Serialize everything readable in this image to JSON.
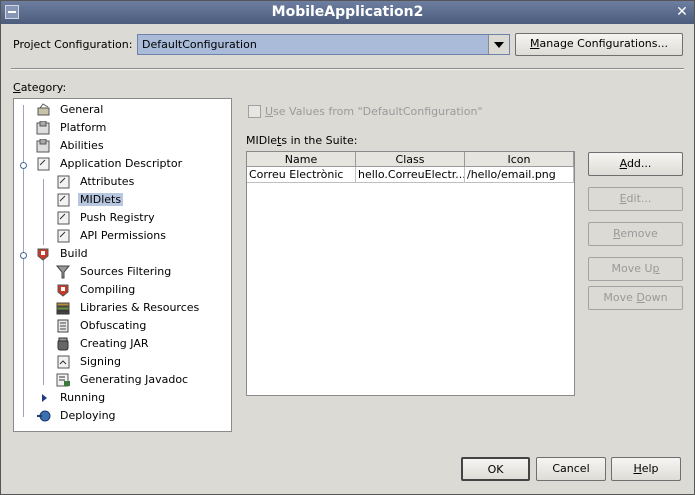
{
  "window": {
    "title": "MobileApplication2"
  },
  "project_config": {
    "label_pre": "Project Confi",
    "label_mn": "g",
    "label_post": "uration:",
    "value": "DefaultConfiguration",
    "manage_pre": "",
    "manage_mn": "M",
    "manage_post": "anage Configurations..."
  },
  "category": {
    "label_mn": "C",
    "label_post": "ategory:"
  },
  "tree": {
    "general": "General",
    "platform": "Platform",
    "abilities": "Abilities",
    "app_descriptor": "Application Descriptor",
    "attributes": "Attributes",
    "midlets": "MIDlets",
    "push_registry": "Push Registry",
    "api_permissions": "API Permissions",
    "build": "Build",
    "sources_filtering": "Sources Filtering",
    "compiling": "Compiling",
    "libraries": "Libraries & Resources",
    "obfuscating": "Obfuscating",
    "creating_jar": "Creating JAR",
    "signing": "Signing",
    "generating_javadoc": "Generating Javadoc",
    "running": "Running",
    "deploying": "Deploying"
  },
  "use_values": {
    "mn": "U",
    "post": "se Values from \"DefaultConfiguration\""
  },
  "midlets_label": {
    "pre": "MIDle",
    "mn": "t",
    "post": "s in the Suite:"
  },
  "table": {
    "headers": [
      "Name",
      "Class",
      "Icon"
    ],
    "rows": [
      [
        "Correu Electrònic",
        "hello.CorreuElectr...",
        "/hello/email.png"
      ]
    ]
  },
  "buttons": {
    "add_mn": "A",
    "add_post": "dd...",
    "edit_mn": "E",
    "edit_post": "dit...",
    "remove_mn": "R",
    "remove_post": "emove",
    "moveup_pre": "Move U",
    "moveup_mn": "p",
    "movedown_pre": "Move ",
    "movedown_mn": "D",
    "movedown_post": "own",
    "ok": "OK",
    "cancel": "Cancel",
    "help_mn": "H",
    "help_post": "elp"
  },
  "colors": {
    "titlebar": "#5a6b8c",
    "selection": "#b7c7e0",
    "combo": "#a9bbd9"
  }
}
